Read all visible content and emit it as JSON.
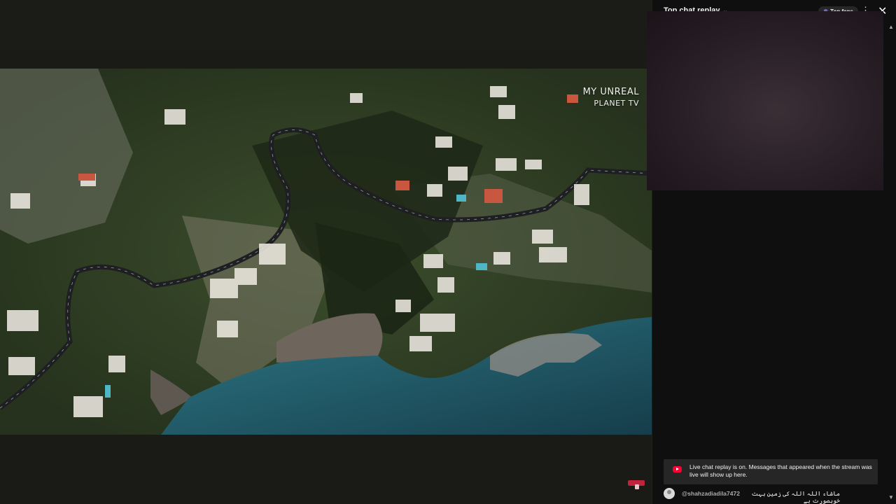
{
  "video": {
    "watermark_line1": "MY UNREAL",
    "watermark_line2": "PLANET TV"
  },
  "chat": {
    "title": "Top chat replay",
    "chevron_icon": "chevron-down-icon",
    "top_fans_label": "Top fans",
    "more_icon": "more-vert-icon",
    "close_icon": "close-icon",
    "notice": {
      "icon": "youtube-icon",
      "text": "Live chat replay is on. Messages that appeared when the stream was live will show up here."
    },
    "messages": [
      {
        "author": "@shahzadiadila7472",
        "text": "ماشاء اللہ اللہ کی زمین بہت خوبصورت ہے"
      }
    ]
  },
  "colors": {
    "accent_red": "#ff0033",
    "panel_bg": "#0f0f0f",
    "notice_bg": "#262626",
    "sea": "#1f5f6e"
  }
}
